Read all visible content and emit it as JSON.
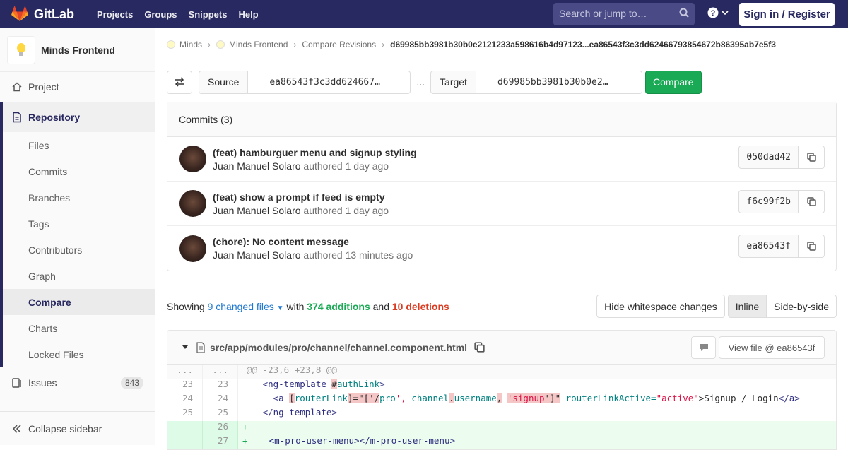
{
  "topbar": {
    "brand": "GitLab",
    "nav": [
      "Projects",
      "Groups",
      "Snippets",
      "Help"
    ],
    "search_placeholder": "Search or jump to…",
    "signin_label": "Sign in / Register"
  },
  "sidebar": {
    "project_name": "Minds Frontend",
    "project_item": "Project",
    "repository_label": "Repository",
    "repo_items": [
      "Files",
      "Commits",
      "Branches",
      "Tags",
      "Contributors",
      "Graph",
      "Compare",
      "Charts",
      "Locked Files"
    ],
    "active_item": "Compare",
    "issues_label": "Issues",
    "issues_count": "843",
    "collapse_label": "Collapse sidebar"
  },
  "breadcrumb": {
    "items": [
      "Minds",
      "Minds Frontend",
      "Compare Revisions"
    ],
    "current": "d69985bb3981b30b0e2121233a598616b4d97123...ea86543f3c3dd62466793854672b86395ab7e5f3"
  },
  "compare": {
    "source_label": "Source",
    "source_value": "ea86543f3c3dd624667…",
    "separator": "...",
    "target_label": "Target",
    "target_value": "d69985bb3981b30b0e2…",
    "compare_button": "Compare"
  },
  "commits": {
    "header": "Commits (3)",
    "authored_word": "authored",
    "items": [
      {
        "title": "(feat) hamburguer menu and signup styling",
        "author": "Juan Manuel Solaro",
        "time": "1 day ago",
        "sha": "050dad42"
      },
      {
        "title": "(feat) show a prompt if feed is empty",
        "author": "Juan Manuel Solaro",
        "time": "1 day ago",
        "sha": "f6c99f2b"
      },
      {
        "title": "(chore): No content message",
        "author": "Juan Manuel Solaro",
        "time": "13 minutes ago",
        "sha": "ea86543f"
      }
    ]
  },
  "stats": {
    "showing": "Showing",
    "changed_files": "9 changed files",
    "with": "with",
    "additions": "374 additions",
    "and": "and",
    "deletions": "10 deletions",
    "hide_whitespace": "Hide whitespace changes",
    "inline": "Inline",
    "side_by_side": "Side-by-side"
  },
  "file": {
    "path": "src/app/modules/pro/channel/channel.component.html",
    "view_file": "View file @ ea86543f",
    "hunk": "@@ -23,6 +23,8 @@",
    "lines": [
      {
        "old": "23",
        "new": "23"
      },
      {
        "old": "24",
        "new": "24"
      },
      {
        "old": "25",
        "new": "25"
      },
      {
        "old": "",
        "new": "26"
      },
      {
        "old": "",
        "new": "27"
      }
    ],
    "meta_dots": "...",
    "code": {
      "l23_tag": "<ng-template",
      "l23_ref": "#",
      "l23_attr": "authLink",
      "l23_end": ">",
      "l24_open": "<a ",
      "l24_b1": "[",
      "l24_attr": "routerLink",
      "l24_b2": "]=\"['/",
      "l24_pro": "pro",
      "l24_q": "',",
      "l24_ch": " channel",
      "l24_dot": ".",
      "l24_un": "username",
      "l24_c": ",",
      "l24_sp": " ",
      "l24_sg": "'signup",
      "l24_close": "']\"",
      "l24_ra": " routerLinkActive=",
      "l24_rv": "\"active\"",
      "l24_text": ">Signup / Login",
      "l24_end": "</a>",
      "l25": "</ng-template>",
      "l26": "+",
      "l27_plus": "+",
      "l27": "<m-pro-user-menu></m-pro-user-menu>"
    }
  }
}
